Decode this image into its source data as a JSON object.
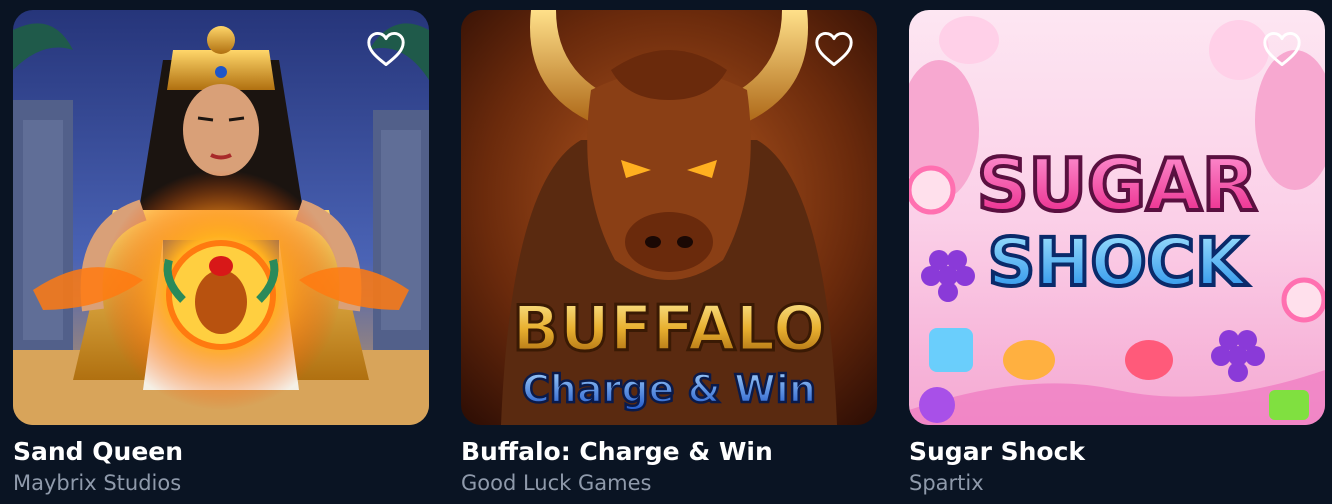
{
  "games": [
    {
      "title": "Sand Queen",
      "provider": "Maybrix Studios",
      "favorite_icon": "heart-outline-icon",
      "colors": {
        "sky": "#3a4f9a",
        "gold": "#e0a020",
        "fire": "#ff8a1a"
      }
    },
    {
      "title": "Buffalo: Charge & Win",
      "provider": "Good Luck Games",
      "logo_line1": "BUFFALO",
      "logo_line2": "Charge & Win",
      "favorite_icon": "heart-outline-icon",
      "colors": {
        "bg": "#5a2a10",
        "gold": "#e8b030",
        "blue": "#2a6ad8"
      }
    },
    {
      "title": "Sugar Shock",
      "provider": "Spartix",
      "logo_line1": "SUGAR",
      "logo_line2": "SHOCK",
      "favorite_icon": "heart-outline-icon",
      "colors": {
        "bg": "#f7c9e6",
        "pink": "#ff3aa0",
        "blue": "#3ab6ff"
      }
    }
  ]
}
